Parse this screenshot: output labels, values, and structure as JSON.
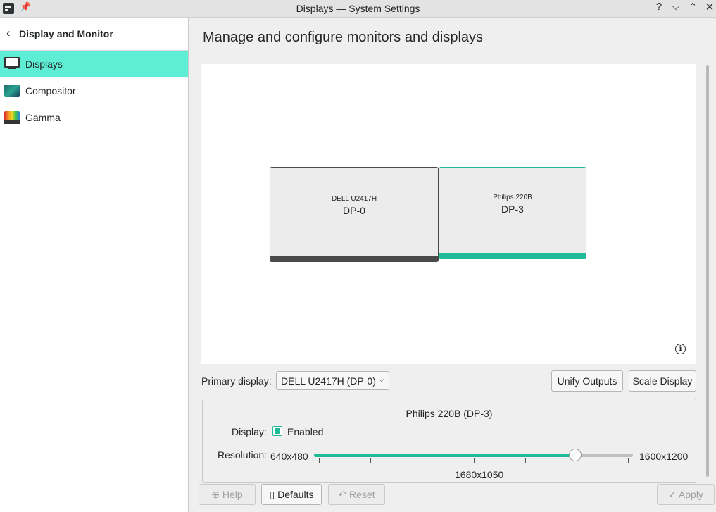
{
  "window": {
    "title": "Displays — System Settings",
    "pin_glyph": "📌",
    "help_glyph": "?",
    "min_glyph": "⌵",
    "max_glyph": "⌃",
    "close_glyph": "✕"
  },
  "sidebar": {
    "header": {
      "back_glyph": "‹",
      "label": "Display and Monitor"
    },
    "items": [
      {
        "label": "Displays",
        "icon": "monitor-icon",
        "active": true
      },
      {
        "label": "Compositor",
        "icon": "compositor-icon",
        "active": false
      },
      {
        "label": "Gamma",
        "icon": "gamma-icon",
        "active": false
      }
    ]
  },
  "main": {
    "title": "Manage and configure monitors and displays",
    "monitors": [
      {
        "name": "DELL U2417H",
        "port": "DP-0",
        "selected": false
      },
      {
        "name": "Philips 220B",
        "port": "DP-3",
        "selected": true
      }
    ],
    "info_glyph": "i",
    "primary_display": {
      "label": "Primary display:",
      "value": "DELL U2417H (DP-0)",
      "arrow_glyph": "⌵"
    },
    "unify_outputs_label": "Unify Outputs",
    "scale_display_label": "Scale Display",
    "details": {
      "title": "Philips 220B (DP-3)",
      "display_label": "Display:",
      "enabled_label": "Enabled",
      "enabled": true,
      "resolution_label": "Resolution:",
      "resolution_min": "640x480",
      "resolution_max": "1600x1200",
      "resolution_current": "1680x1050",
      "slider_fraction": 0.82
    }
  },
  "footer": {
    "help_label": "Help",
    "defaults_label": "Defaults",
    "reset_label": "Reset",
    "apply_label": "Apply"
  },
  "colors": {
    "accent": "#1fbb98",
    "selection": "#5eeed6"
  }
}
